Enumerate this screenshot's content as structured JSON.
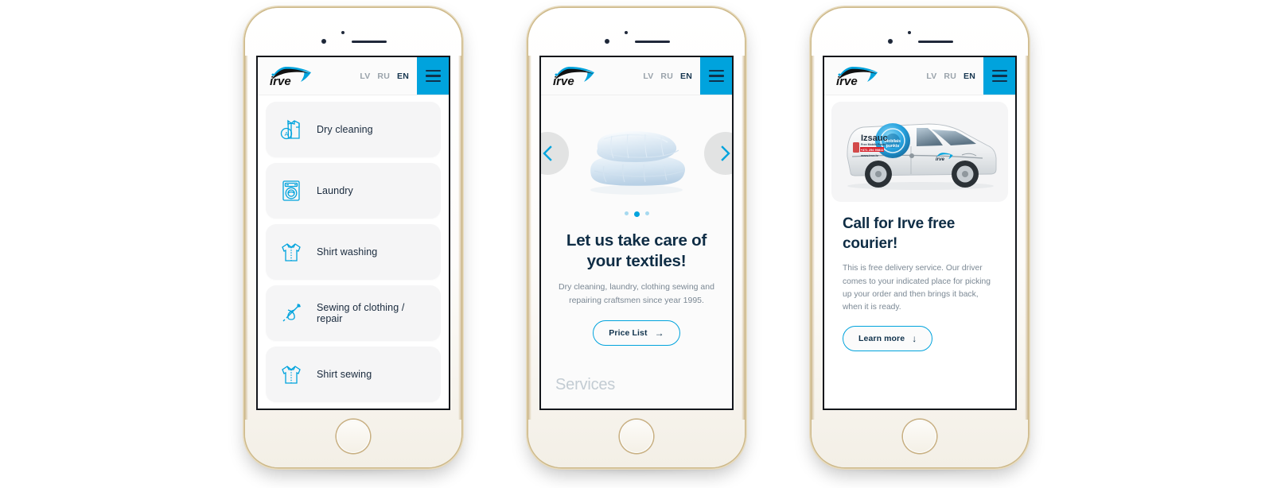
{
  "header": {
    "logo_text": "irve",
    "languages": [
      {
        "code": "LV",
        "active": false
      },
      {
        "code": "RU",
        "active": false
      },
      {
        "code": "EN",
        "active": true
      }
    ],
    "menu_label": "menu"
  },
  "colors": {
    "accent": "#00a3dd",
    "dark_navy": "#0f2d45",
    "muted_text": "#7b8894",
    "card_bg": "#f5f5f6",
    "page_bg": "#ffffff"
  },
  "phone1": {
    "services": [
      {
        "label": "Dry cleaning",
        "icon": "dry-cleaning-icon"
      },
      {
        "label": "Laundry",
        "icon": "washing-machine-icon"
      },
      {
        "label": "Shirt washing",
        "icon": "shirt-icon"
      },
      {
        "label": "Sewing of clothing / repair",
        "icon": "needle-thread-icon"
      },
      {
        "label": "Shirt sewing",
        "icon": "shirt-icon"
      }
    ]
  },
  "phone2": {
    "slide_image_alt": "stack-of-pillows",
    "prev_label": "previous slide",
    "next_label": "next slide",
    "dots": [
      false,
      true,
      false
    ],
    "title": "Let us take care of your textiles!",
    "subtitle": "Dry cleaning, laundry, clothing sewing and repairing craftsmen since year 1995.",
    "cta_label": "Price List",
    "cta_arrow": "→",
    "section_heading": "Services"
  },
  "phone3": {
    "van_alt": "irve-delivery-van",
    "van_decal_title": "Izsauc",
    "van_decal_sub": "Free Mobile Punkt",
    "van_decal_phone": "+371 254 90811",
    "van_decal_site": "www.irve.lv",
    "van_badge_text": "Mobilais punkts",
    "title": "Call for Irve free courier!",
    "body": "This is free delivery service. Our driver comes to your indicated place for picking up your order and then brings it back, when it is ready.",
    "cta_label": "Learn more",
    "cta_arrow": "↓"
  }
}
